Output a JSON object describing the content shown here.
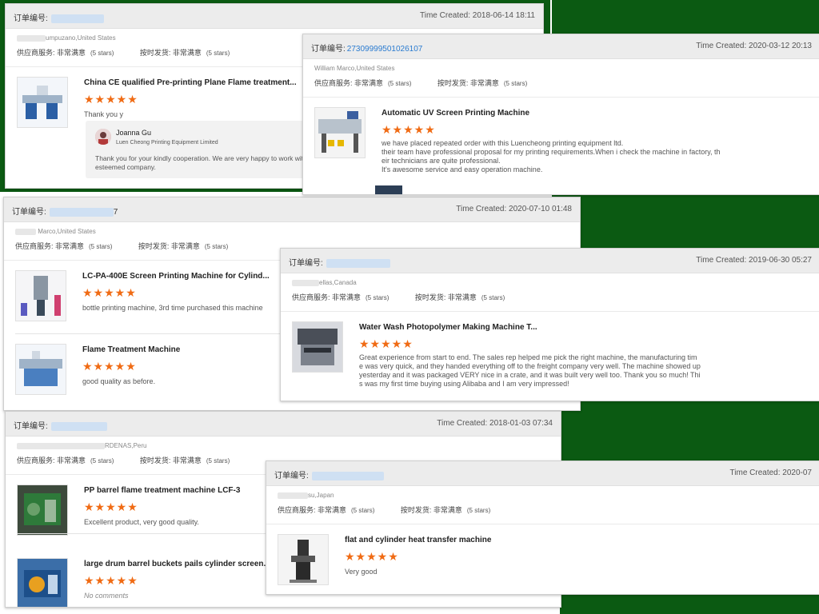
{
  "labels": {
    "order": "订单编号:",
    "supplier_service": "供应商服务: 非常满意",
    "on_time": "按时发货: 非常满意",
    "stars5": "(5 stars)",
    "star_glyphs": "★★★★★"
  },
  "cards": [
    {
      "order_suffix": "",
      "time": "Time Created: 2018-06-14 18:11",
      "buyer": "umpuzano,United States",
      "products": [
        {
          "title": "China CE qualified Pre-printing Plane Flame treatment...",
          "review": "Thank you y"
        }
      ],
      "reply": {
        "name": "Joanna Gu",
        "company": "Luen Cheong Printing Equipment Limited",
        "text_l1": "Thank you for your kindly cooperation. We are very happy to work wit",
        "text_l2": "esteemed company."
      }
    },
    {
      "order_no": "27309999501026107",
      "time": "Time Created: 2020-03-12 20:13",
      "buyer": "William Marco,United States",
      "products": [
        {
          "title": "Automatic UV Screen Printing Machine",
          "review_l1": "we have placed repeated order with this Luencheong printing equipment ltd.",
          "review_l2": "their team have professional proposal for my printing requirements.When i check the machine in factory, th",
          "review_l3": "eir technicians are quite professional.",
          "review_l4": "It's awesome service and easy operation machine."
        }
      ]
    },
    {
      "order_suffix": "7",
      "time": "Time Created: 2020-07-10 01:48",
      "buyer": "Marco,United States",
      "products": [
        {
          "title": "LC-PA-400E Screen Printing Machine for Cylind...",
          "review": "bottle printing machine, 3rd time purchased this machine"
        },
        {
          "title": "Flame Treatment Machine",
          "review": "good quality as before."
        }
      ]
    },
    {
      "order_suffix": "",
      "time": "Time Created: 2019-06-30 05:27",
      "buyer": "ellas,Canada",
      "products": [
        {
          "title": "Water Wash Photopolymer Making Machine T...",
          "review_l1": "Great experience from start to end.  The sales rep helped me pick the right machine, the manufacturing tim",
          "review_l2": "e was very quick, and they handed everything off to the freight company very well.  The machine showed up",
          "review_l3": "yesterday and it was packaged VERY nice in a crate, and it was built very well too.  Thank you so much! Thi",
          "review_l4": "s was my first time buying using Alibaba and I am very impressed!"
        }
      ]
    },
    {
      "order_suffix": "",
      "time": "Time Created: 2018-01-03 07:34",
      "buyer": "RDENAS,Peru",
      "products": [
        {
          "title": "PP barrel flame treatment machine LCF-3",
          "review": "Excellent product, very good quality."
        },
        {
          "title": "large drum barrel buckets pails cylinder screen...",
          "review": "No comments"
        }
      ]
    },
    {
      "order_suffix": "",
      "time": "Time Created: 2020-07",
      "buyer": "su,Japan",
      "products": [
        {
          "title": "flat and cylinder heat transfer machine",
          "review": "Very  good"
        }
      ]
    }
  ]
}
